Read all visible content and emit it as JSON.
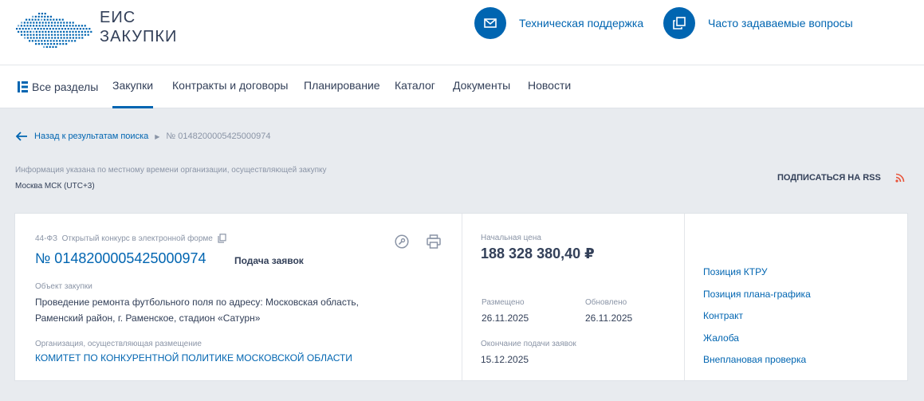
{
  "header": {
    "logo_line1": "ЕИС",
    "logo_line2": "ЗАКУПКИ",
    "support_label": "Техническая поддержка",
    "faq_label": "Часто задаваемые вопросы"
  },
  "nav": {
    "all_sections": "Все разделы",
    "items": [
      "Закупки",
      "Контракты и договоры",
      "Планирование",
      "Каталог",
      "Документы",
      "Новости"
    ],
    "active": "Закупки"
  },
  "breadcrumb": {
    "back_label": "Назад к результатам поиска",
    "current": "№ 0148200005425000974"
  },
  "timezone": {
    "note": "Информация указана по местному времени организации, осуществляющей закупку",
    "value": "Москва МСК (UTC+3)"
  },
  "rss_label": "ПОДПИСАТЬСЯ НА RSS",
  "purchase": {
    "law_type": "44-ФЗ  Открытый конкурс в электронной форме",
    "number": "№ 0148200005425000974",
    "stage": "Подача заявок",
    "object_label": "Объект закупки",
    "object_line1": "Проведение ремонта футбольного поля по адресу: Московская область,",
    "object_line2": "Раменский район, г. Раменское, стадион «Сатурн»",
    "org_label": "Организация, осуществляющая размещение",
    "org_name": "КОМИТЕТ ПО КОНКУРЕНТНОЙ ПОЛИТИКЕ МОСКОВСКОЙ ОБЛАСТИ"
  },
  "price": {
    "label": "Начальная цена",
    "value": "188 328 380,40 ₽"
  },
  "dates": {
    "posted_label": "Размещено",
    "posted": "26.11.2025",
    "updated_label": "Обновлено",
    "updated": "26.11.2025",
    "deadline_label": "Окончание подачи заявок",
    "deadline": "15.12.2025"
  },
  "related_links": [
    "Позиция КТРУ",
    "Позиция плана-графика",
    "Контракт",
    "Жалоба",
    "Внеплановая проверка"
  ],
  "colors": {
    "accent": "#0065b1",
    "rss": "#e8543a",
    "text": "#334059",
    "muted": "#8a94a6"
  },
  "icons": {
    "support": "mail-icon",
    "faq": "copy-windows-icon",
    "sections": "sections-grid-icon",
    "back": "arrow-left-icon",
    "copy": "copy-icon",
    "journal": "journal-icon",
    "print": "printer-icon",
    "rss": "rss-icon"
  }
}
